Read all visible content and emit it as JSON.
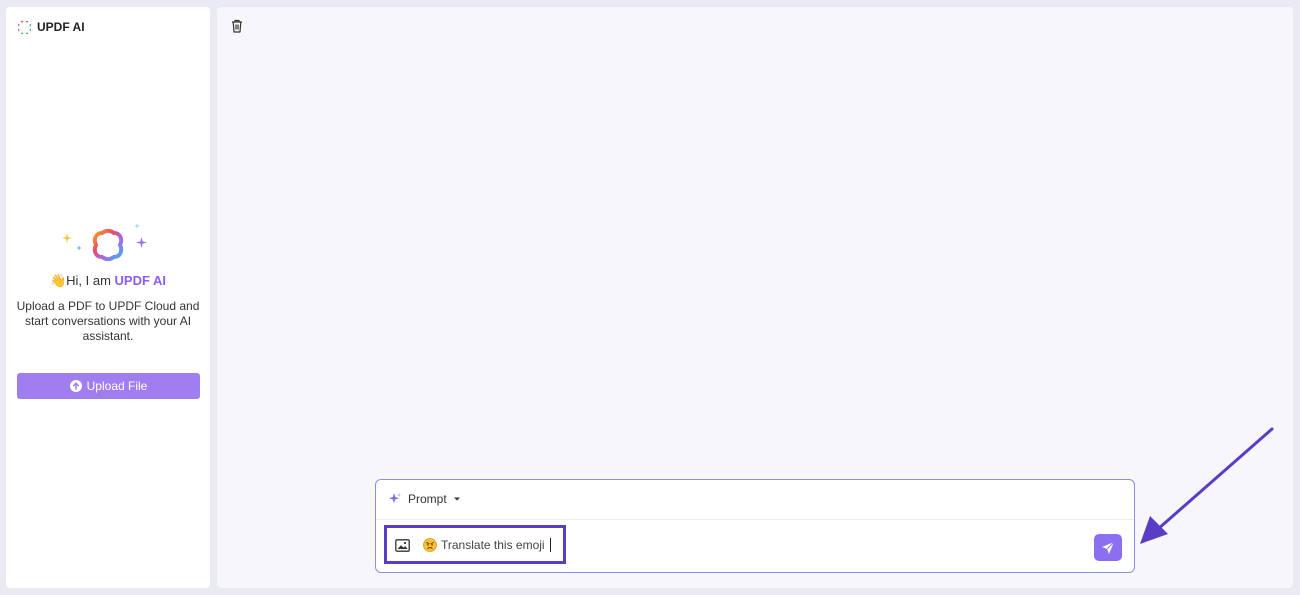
{
  "sidebar": {
    "brand_name": "UPDF AI",
    "greeting_prefix": "Hi, I am ",
    "greeting_wave": "👋",
    "greeting_brand": "UPDF AI",
    "intro_text": "Upload a PDF to UPDF Cloud and start conversations with your AI assistant.",
    "upload_button_label": "Upload File"
  },
  "chat": {
    "prompt_label": "Prompt",
    "input_text": "Translate this emoji"
  },
  "colors": {
    "accent": "#8b5cf6",
    "upload_button": "#a07ef0",
    "send_button": "#8b6ff0",
    "annotation": "#5b3cc4"
  },
  "icons": {
    "brand_logo": "updf-logo-icon",
    "trash": "trash-icon",
    "prompt": "sparkle-icon",
    "prompt_dropdown": "caret-down-icon",
    "attach_image": "image-icon",
    "emoji": "angry-face-emoji-icon",
    "send": "send-icon",
    "upload": "arrow-up-circle-icon"
  }
}
